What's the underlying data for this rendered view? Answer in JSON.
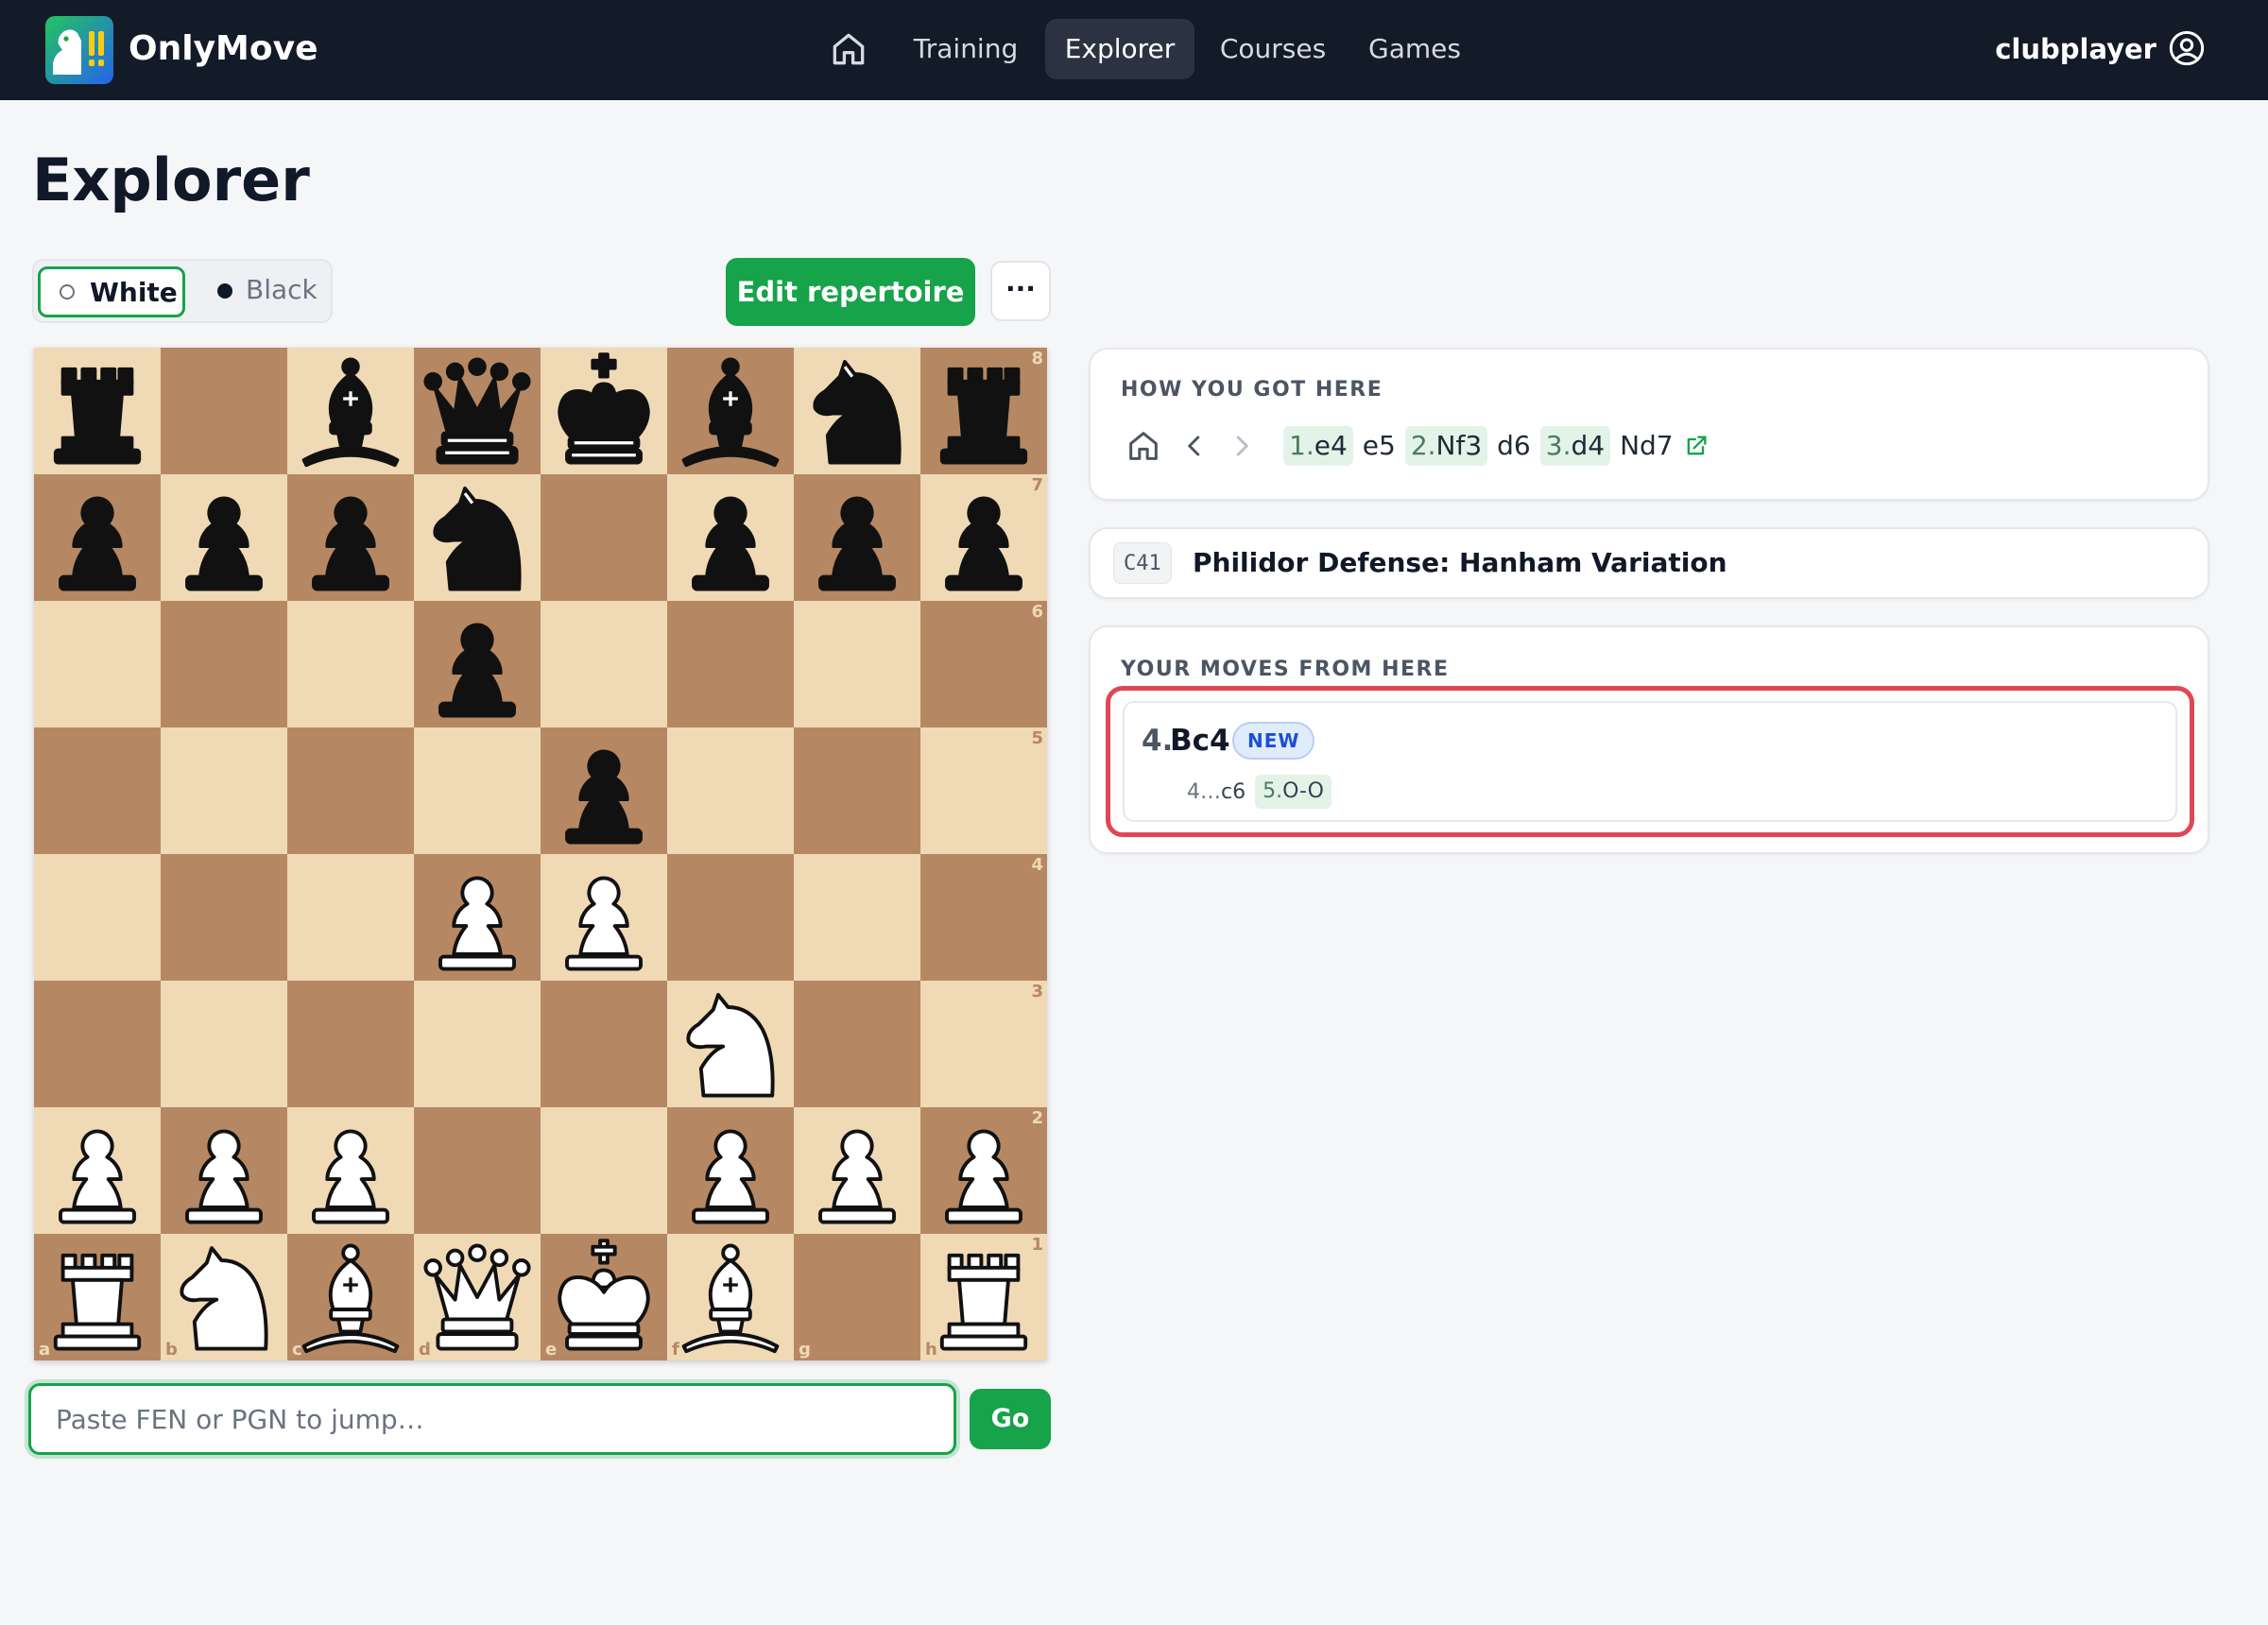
{
  "app": {
    "name": "OnlyMove"
  },
  "nav": {
    "items": [
      {
        "label": "Training",
        "active": false
      },
      {
        "label": "Explorer",
        "active": true
      },
      {
        "label": "Courses",
        "active": false
      },
      {
        "label": "Games",
        "active": false
      }
    ],
    "user": "clubplayer"
  },
  "page": {
    "title": "Explorer"
  },
  "side_toggle": {
    "white_label": "White",
    "black_label": "Black",
    "selected": "White"
  },
  "toolbar": {
    "edit_label": "Edit repertoire",
    "more_label": "···"
  },
  "board": {
    "orientation": "white",
    "files": [
      "a",
      "b",
      "c",
      "d",
      "e",
      "f",
      "g",
      "h"
    ],
    "ranks": [
      "8",
      "7",
      "6",
      "5",
      "4",
      "3",
      "2",
      "1"
    ],
    "position": [
      [
        "r",
        "",
        "b",
        "q",
        "k",
        "b",
        "n",
        "r"
      ],
      [
        "p",
        "p",
        "p",
        "n",
        "",
        "p",
        "p",
        "p"
      ],
      [
        "",
        "",
        "",
        "p",
        "",
        "",
        "",
        ""
      ],
      [
        "",
        "",
        "",
        "",
        "p",
        "",
        "",
        ""
      ],
      [
        "",
        "",
        "",
        "P",
        "P",
        "",
        "",
        ""
      ],
      [
        "",
        "",
        "",
        "",
        "",
        "N",
        "",
        ""
      ],
      [
        "P",
        "P",
        "P",
        "",
        "",
        "P",
        "P",
        "P"
      ],
      [
        "R",
        "N",
        "B",
        "Q",
        "K",
        "B",
        "",
        "R"
      ]
    ],
    "colors": {
      "light": "#f0d9b5",
      "dark": "#b58863"
    }
  },
  "fen_input": {
    "placeholder": "Paste FEN or PGN to jump…",
    "value": "",
    "go_label": "Go"
  },
  "how_you_got_here": {
    "title": "HOW YOU GOT HERE",
    "moves": [
      {
        "num": "1.",
        "san": "e4",
        "highlight": true
      },
      {
        "num": "",
        "san": "e5",
        "highlight": false
      },
      {
        "num": "2.",
        "san": "Nf3",
        "highlight": true
      },
      {
        "num": "",
        "san": "d6",
        "highlight": false
      },
      {
        "num": "3.",
        "san": "d4",
        "highlight": true
      },
      {
        "num": "",
        "san": "Nd7",
        "highlight": false
      }
    ]
  },
  "opening": {
    "eco": "C41",
    "name": "Philidor Defense: Hanham Variation"
  },
  "your_moves": {
    "title": "YOUR MOVES FROM HERE",
    "items": [
      {
        "num": "4.",
        "san": "Bc4",
        "badge": "NEW",
        "continuation": [
          {
            "num": "4…",
            "san": "c6"
          },
          {
            "num": "5.",
            "san": "O-O"
          }
        ]
      }
    ]
  },
  "colors": {
    "accent": "#16a34a",
    "nav_bg": "#131a28",
    "highlight_ring": "#e04755",
    "badge_blue": "#1d4ed8"
  }
}
